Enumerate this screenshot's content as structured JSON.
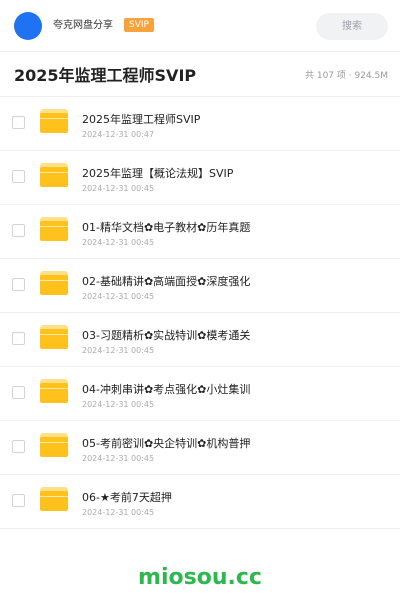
{
  "header": {
    "share_name": "夸克网盘分享",
    "badge": "SVIP",
    "search_label": "搜索",
    "avatar_color": "#1f72f2",
    "badge_color": "#f7a23a"
  },
  "title_bar": {
    "title": "2025年监理工程师SVIP",
    "meta": "共 107 项 · 924.5M"
  },
  "files": [
    {
      "name": "2025年监理工程师SVIP",
      "date": "2024-12-31 00:47"
    },
    {
      "name": "2025年监理【概论法规】SVIP",
      "date": "2024-12-31 00:45"
    },
    {
      "name": "01-精华文档✿电子教材✿历年真题",
      "date": "2024-12-31 00:45"
    },
    {
      "name": "02-基础精讲✿高端面授✿深度强化",
      "date": "2024-12-31 00:45"
    },
    {
      "name": "03-习题精析✿实战特训✿模考通关",
      "date": "2024-12-31 00:45"
    },
    {
      "name": "04-冲刺串讲✿考点强化✿小灶集训",
      "date": "2024-12-31 00:45"
    },
    {
      "name": "05-考前密训✿央企特训✿机构普押",
      "date": "2024-12-31 00:45"
    },
    {
      "name": "06-★考前7天超押",
      "date": "2024-12-31 00:45"
    }
  ],
  "watermark": "miosou.cc",
  "colors": {
    "folder": "#ffc21c",
    "watermark": "#2db84f"
  }
}
